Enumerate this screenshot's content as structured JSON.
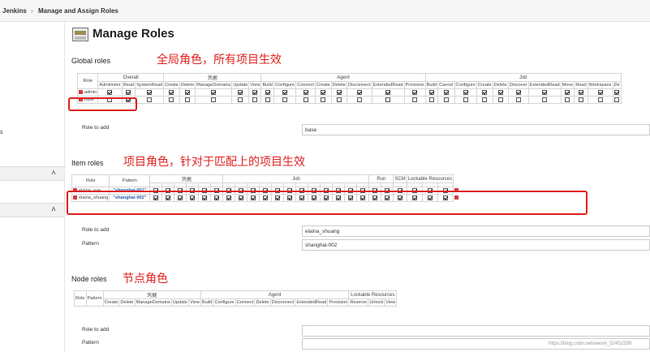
{
  "breadcrumbs": [
    "Jenkins",
    "Manage and Assign Roles"
  ],
  "sidebar": {
    "fragment": "s"
  },
  "page_title": "Manage Roles",
  "global": {
    "section_title": "Global roles",
    "annotation": "全局角色，所有项目生效",
    "role_header": "Role",
    "groups": [
      "Overall",
      "凭据",
      "Agent",
      "Job"
    ],
    "columns": [
      "Administer",
      "Read",
      "SystemRead",
      "Create",
      "Delete",
      "ManageDomains",
      "Update",
      "View",
      "Build",
      "Configure",
      "Connect",
      "Create",
      "Delete",
      "Disconnect",
      "ExtendedRead",
      "Provision",
      "Build",
      "Cancel",
      "Configure",
      "Create",
      "Delete",
      "Discover",
      "ExtendedRead",
      "Move",
      "Read",
      "Workspace",
      "De"
    ],
    "rows": [
      {
        "name": "admin",
        "checks": [
          true,
          true,
          true,
          true,
          true,
          true,
          true,
          true,
          true,
          true,
          true,
          true,
          true,
          true,
          true,
          true,
          true,
          true,
          true,
          true,
          true,
          true,
          true,
          true,
          true,
          true,
          true
        ]
      },
      {
        "name": "base",
        "checks": [
          false,
          true,
          false,
          false,
          false,
          false,
          false,
          false,
          false,
          false,
          false,
          false,
          false,
          false,
          false,
          false,
          false,
          false,
          false,
          false,
          false,
          false,
          false,
          false,
          false,
          false,
          false
        ]
      }
    ],
    "role_to_add_label": "Role to add",
    "role_to_add_value": "base"
  },
  "item": {
    "section_title": "Item roles",
    "annotation": "项目角色，针对于匹配上的项目生效",
    "role_header": "Role",
    "pattern_header": "Pattern",
    "groups": [
      "凭据",
      "Job",
      "Run",
      "SCM",
      "Lockable Resources"
    ],
    "rows": [
      {
        "name": "elaina_xue",
        "pattern": "\"shanghai-001\"",
        "checks": [
          true,
          true,
          true,
          true,
          true,
          true,
          true,
          true,
          true,
          true,
          true,
          true,
          true,
          true,
          true,
          true,
          true,
          true,
          true,
          true,
          true,
          true,
          true,
          true
        ]
      },
      {
        "name": "elaina_shuang",
        "pattern": "\"shanghai-002\"",
        "checks": [
          true,
          true,
          true,
          true,
          true,
          true,
          true,
          true,
          true,
          true,
          true,
          true,
          true,
          true,
          true,
          true,
          true,
          true,
          true,
          true,
          true,
          true,
          true,
          true
        ]
      }
    ],
    "role_to_add_label": "Role to add",
    "role_to_add_value": "elaina_shuang",
    "pattern_label": "Pattern",
    "pattern_value": "shanghai-002"
  },
  "node": {
    "section_title": "Node roles",
    "annotation": "节点角色",
    "role_header": "Role",
    "pattern_header": "Pattern",
    "groups": [
      "凭据",
      "Agent",
      "Lockable Resources"
    ],
    "columns": [
      "Create",
      "Delete",
      "ManageDomains",
      "Update",
      "View",
      "Build",
      "Configure",
      "Connect",
      "Delete",
      "Disconnect",
      "ExtendedRead",
      "Provision",
      "Reserve",
      "Unlock",
      "View"
    ],
    "role_to_add_label": "Role to add",
    "pattern_label": "Pattern"
  },
  "watermark": "https://blog.csdn.net/weixin_52452299",
  "colors": {
    "annotation": "#e02020",
    "pattern": "#2255aa",
    "delete": "#d23c3c"
  }
}
